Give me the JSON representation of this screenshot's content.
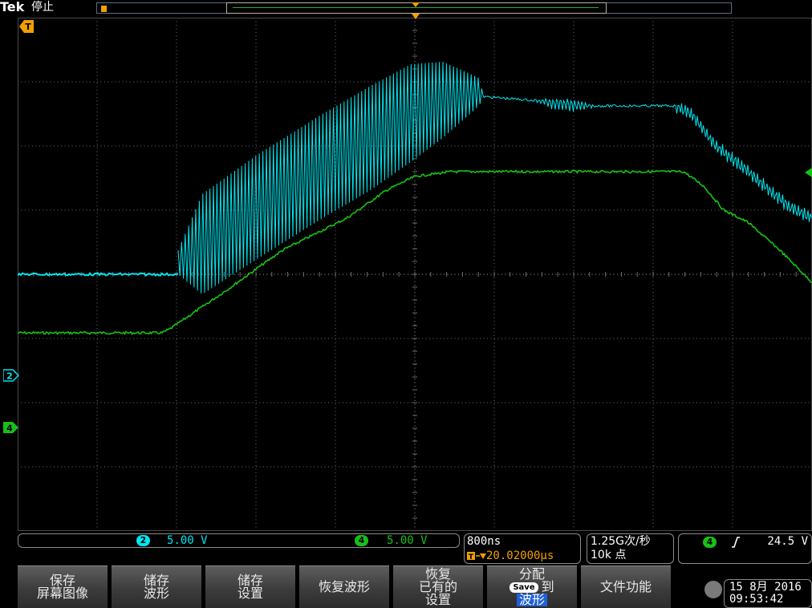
{
  "header": {
    "brand": "Tek",
    "status": "停止"
  },
  "channels": [
    {
      "id": "2",
      "color": "#00e6f0",
      "scale": "5.00 V"
    },
    {
      "id": "4",
      "color": "#17c117",
      "scale": "5.00 V"
    }
  ],
  "timebase": {
    "scale": "800ns",
    "delay": "20.02000μs"
  },
  "acquisition": {
    "rate": "1.25G次/秒",
    "points": "10k 点"
  },
  "trigger": {
    "source": "4",
    "slope": "rising-edge-icon",
    "level": "24.5 V"
  },
  "softkeys": [
    {
      "line1": "保存",
      "line2": "屏幕图像"
    },
    {
      "line1": "储存",
      "line2": "波形"
    },
    {
      "line1": "储存",
      "line2": "设置"
    },
    {
      "line1": "恢复波形"
    },
    {
      "line1": "恢复",
      "line2": "已有的",
      "line3": "设置"
    },
    {
      "line1": "分配",
      "save_badge": "Save",
      "line2b": "到",
      "highlight": "波形"
    },
    {
      "line1": "文件功能"
    }
  ],
  "datetime": {
    "date": "15 8月 2016",
    "time": "09:53:42"
  },
  "colors": {
    "ch2": "#00e6f0",
    "ch4": "#17c117",
    "trigger": "#f0a000",
    "grid": "#6e6e6e"
  }
}
